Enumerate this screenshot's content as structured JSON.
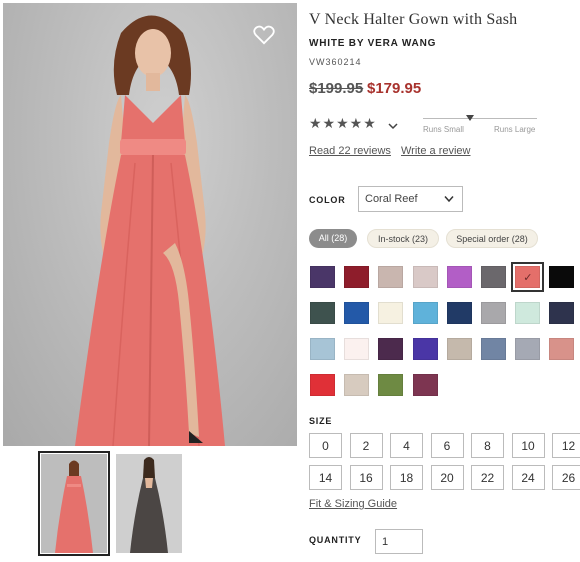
{
  "product": {
    "title": "V Neck Halter Gown with Sash",
    "brand": "WHITE BY VERA WANG",
    "sku": "VW360214",
    "price_original": "$199.95",
    "price_sale": "$179.95"
  },
  "rating": {
    "stars_display": "★★★★★",
    "value": 4.5,
    "max": 5
  },
  "fit": {
    "left_label": "Runs Small",
    "right_label": "Runs Large",
    "position": 0.5
  },
  "links": {
    "read_reviews": "Read 22 reviews",
    "write_review": "Write a review",
    "sizing_guide": "Fit & Sizing Guide"
  },
  "color": {
    "label": "COLOR",
    "selected": "Coral Reef"
  },
  "filters": [
    {
      "label": "All (28)",
      "active": true
    },
    {
      "label": "In-stock (23)",
      "active": false
    },
    {
      "label": "Special order (28)",
      "active": false
    }
  ],
  "swatches": [
    "#4a3668",
    "#8e1d2b",
    "#c9b6af",
    "#d9c9c7",
    "#b25ec6",
    "#6b686c",
    "#e46f6a",
    "#0a0a0a",
    "#3e524e",
    "#2359a8",
    "#f6f1e1",
    "#5fb2da",
    "#213a66",
    "#a9a8ab",
    "#cfe9dd",
    "#2e334d",
    "#a7c4d6",
    "#fbf1ef",
    "#4c2a4d",
    "#4a36a6",
    "#c5b9ac",
    "#7185a4",
    "#a5a9b4",
    "#d8928a",
    "#e03037",
    "#d7cbbf",
    "#6e8a43",
    "#7d3551"
  ],
  "selected_swatch_index": 6,
  "selected_check": "✓",
  "size": {
    "label": "SIZE",
    "options": [
      "0",
      "2",
      "4",
      "6",
      "8",
      "10",
      "12",
      "14",
      "16",
      "18",
      "20",
      "22",
      "24",
      "26"
    ]
  },
  "quantity": {
    "label": "QUANTITY",
    "value": "1"
  },
  "colors": {
    "gown": "#e5716c",
    "sale_price": "#a8322d",
    "selected_swatch": "#e46f6a"
  },
  "icons": {
    "favorite": "heart-icon",
    "rating_dropdown": "chevron-down-icon",
    "select_dropdown": "chevron-down-icon"
  }
}
